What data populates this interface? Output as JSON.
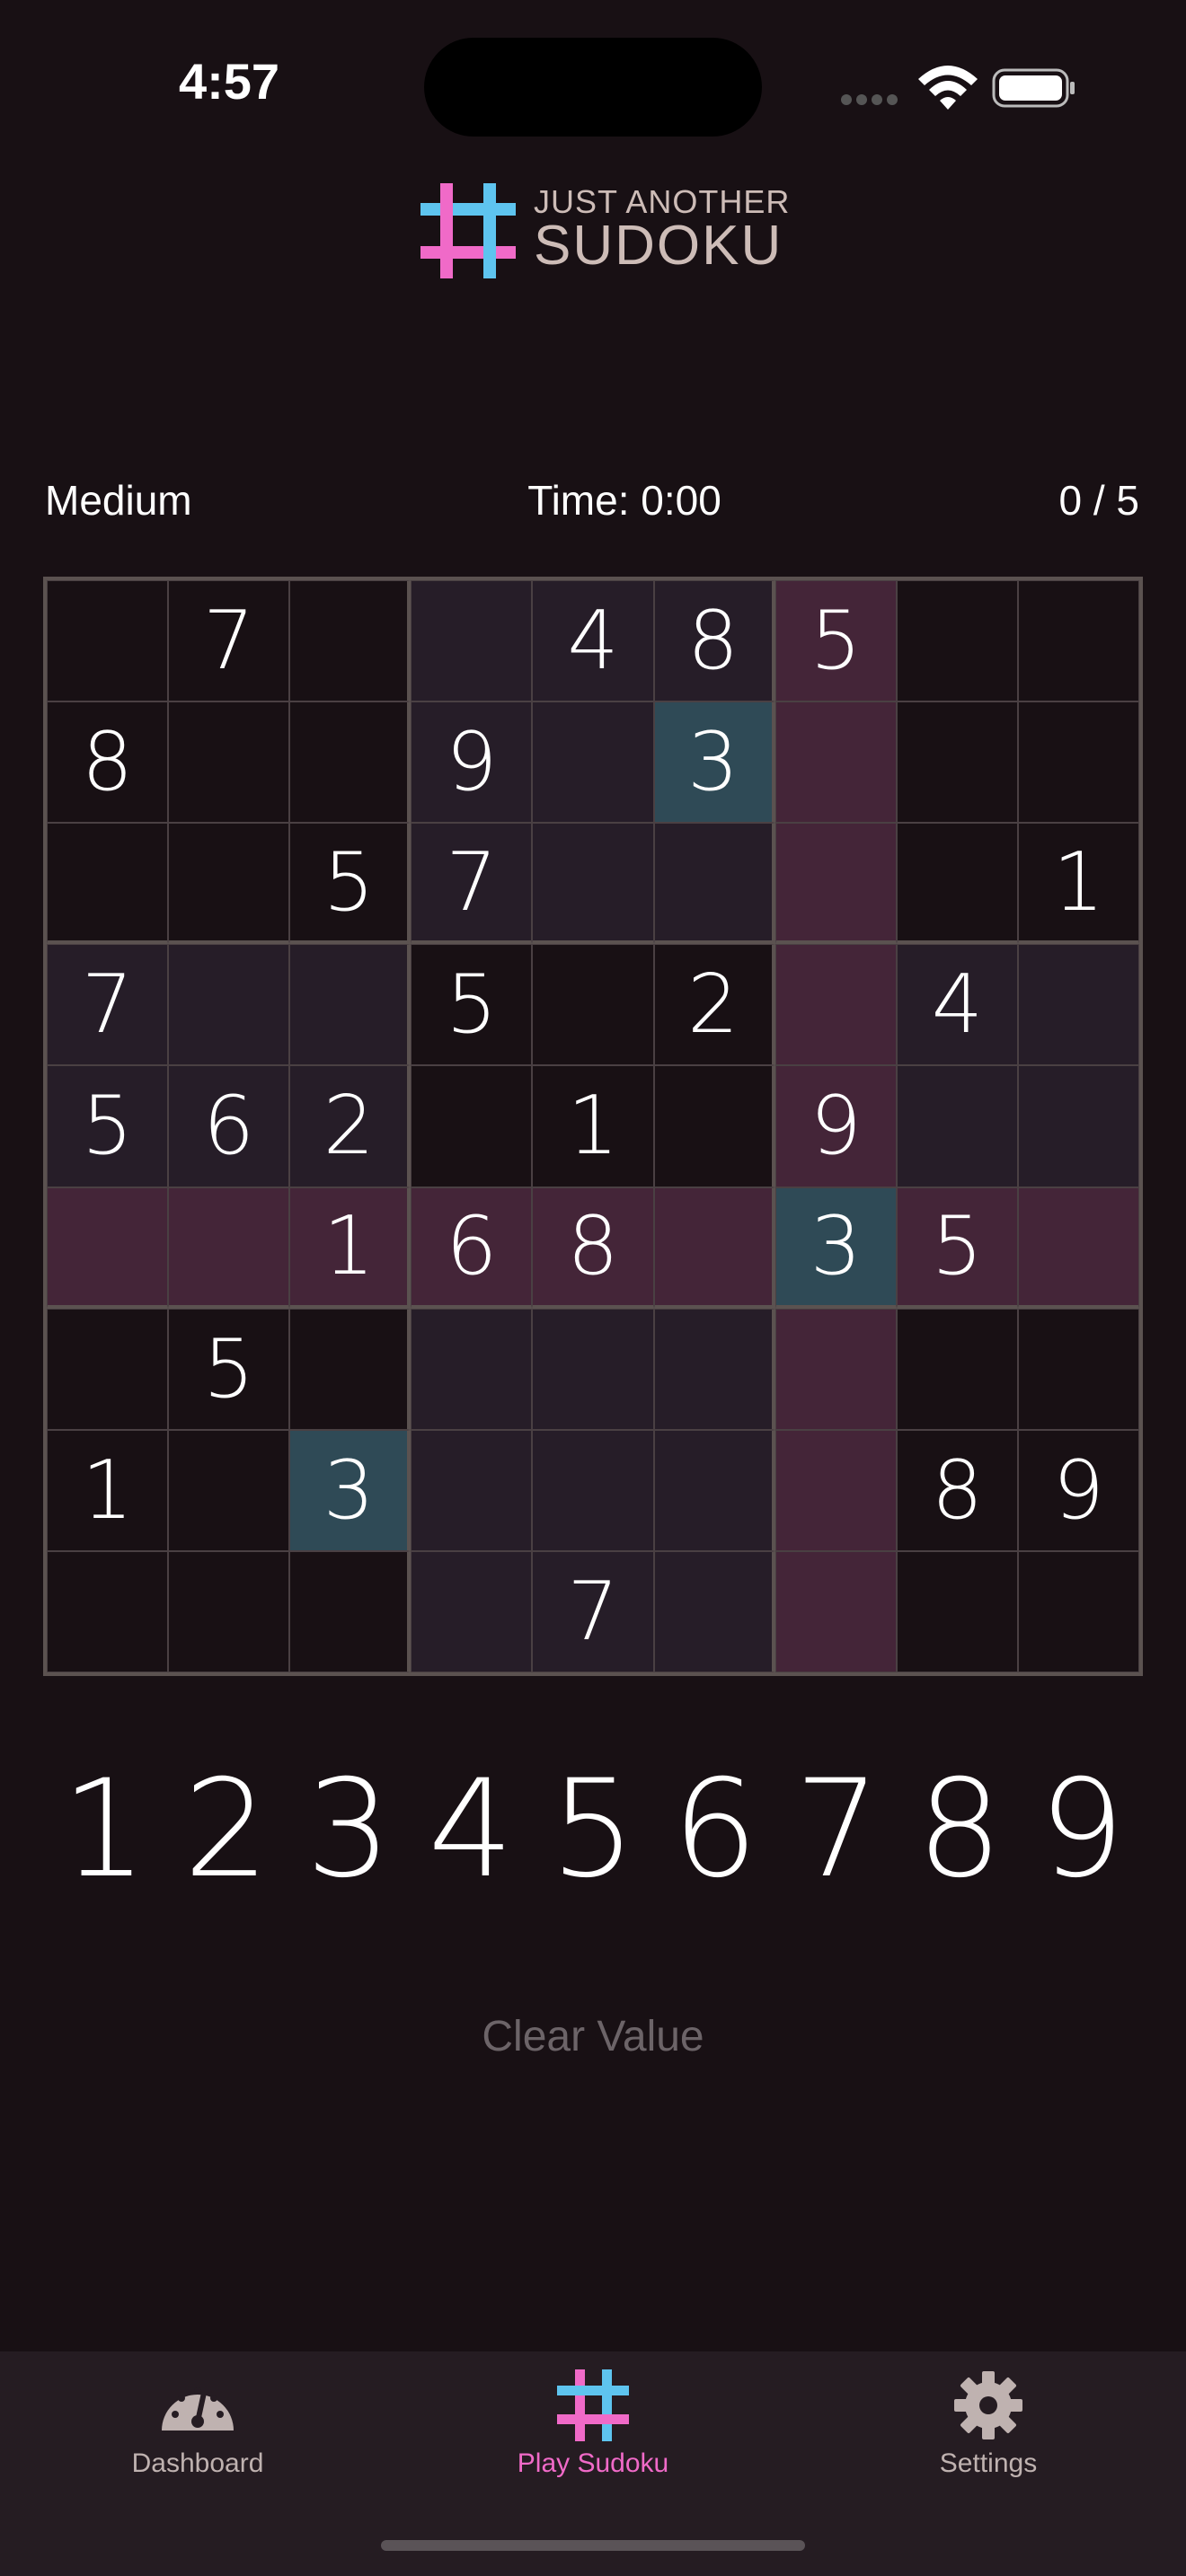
{
  "status_bar": {
    "time": "4:57"
  },
  "header": {
    "logo_line1": "JUST ANOTHER",
    "logo_line2": "SUDOKU"
  },
  "info": {
    "difficulty": "Medium",
    "timer": "Time: 0:00",
    "score": "0 / 5"
  },
  "colors": {
    "background": "#181014",
    "box_highlight": "#261d28",
    "line_highlight": "#442538",
    "selected_value": "#2f4a56",
    "accent_pink": "#f06ac8",
    "accent_blue": "#5ec4ef"
  },
  "grid": [
    [
      "",
      "7",
      "",
      "",
      "4",
      "8",
      "5",
      "",
      ""
    ],
    [
      "8",
      "",
      "",
      "9",
      "",
      "3",
      "",
      "",
      ""
    ],
    [
      "",
      "",
      "5",
      "7",
      "",
      "",
      "",
      "",
      "1"
    ],
    [
      "7",
      "",
      "",
      "5",
      "",
      "2",
      "",
      "4",
      ""
    ],
    [
      "5",
      "6",
      "2",
      "",
      "1",
      "",
      "9",
      "",
      ""
    ],
    [
      "",
      "",
      "1",
      "6",
      "8",
      "",
      "3",
      "5",
      ""
    ],
    [
      "",
      "5",
      "",
      "",
      "",
      "",
      "",
      "",
      ""
    ],
    [
      "1",
      "",
      "3",
      "",
      "",
      "",
      "",
      "8",
      "9"
    ],
    [
      "",
      "",
      "",
      "",
      "7",
      "",
      "",
      "",
      ""
    ]
  ],
  "cell_backgrounds": [
    [
      "none",
      "none",
      "none",
      "box",
      "box",
      "box",
      "line",
      "none",
      "none"
    ],
    [
      "none",
      "none",
      "none",
      "box",
      "box",
      "sel",
      "line",
      "none",
      "none"
    ],
    [
      "none",
      "none",
      "none",
      "box",
      "box",
      "box",
      "line",
      "none",
      "none"
    ],
    [
      "box",
      "box",
      "box",
      "none",
      "none",
      "none",
      "line",
      "box",
      "box"
    ],
    [
      "box",
      "box",
      "box",
      "none",
      "none",
      "none",
      "line",
      "box",
      "box"
    ],
    [
      "line",
      "line",
      "line",
      "line",
      "line",
      "line",
      "sel",
      "line",
      "line"
    ],
    [
      "none",
      "none",
      "none",
      "box",
      "box",
      "box",
      "line",
      "none",
      "none"
    ],
    [
      "none",
      "none",
      "sel",
      "box",
      "box",
      "box",
      "line",
      "none",
      "none"
    ],
    [
      "none",
      "none",
      "none",
      "box",
      "box",
      "box",
      "line",
      "none",
      "none"
    ]
  ],
  "numpad": [
    "1",
    "2",
    "3",
    "4",
    "5",
    "6",
    "7",
    "8",
    "9"
  ],
  "actions": {
    "clear_value": "Clear Value"
  },
  "tabs": [
    {
      "label": "Dashboard",
      "icon": "dashboard-gauge-icon",
      "active": false
    },
    {
      "label": "Play Sudoku",
      "icon": "sudoku-hash-icon",
      "active": true
    },
    {
      "label": "Settings",
      "icon": "gear-icon",
      "active": false
    }
  ]
}
